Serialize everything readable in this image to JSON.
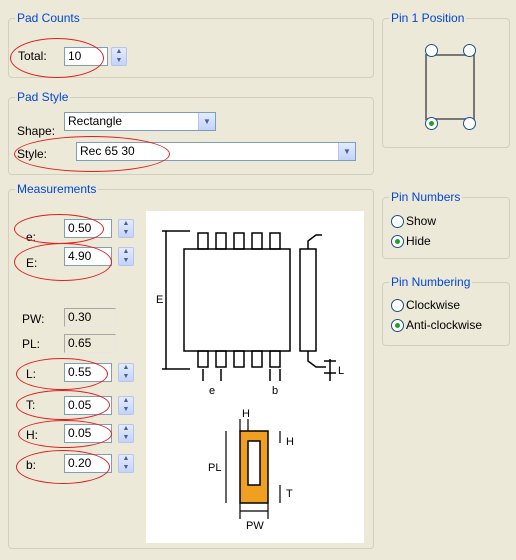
{
  "pad_counts": {
    "title": "Pad Counts",
    "total_label": "Total:",
    "total_value": "10"
  },
  "pad_style": {
    "title": "Pad Style",
    "shape_label": "Shape:",
    "shape_value": "Rectangle",
    "style_label": "Style:",
    "style_value": "Rec 65 30"
  },
  "measurements": {
    "title": "Measurements",
    "e_label": "e:",
    "e_value": "0.50",
    "E_label": "E:",
    "E_value": "4.90",
    "PW_label": "PW:",
    "PW_value": "0.30",
    "PL_label": "PL:",
    "PL_value": "0.65",
    "L_label": "L:",
    "L_value": "0.55",
    "T_label": "T:",
    "T_value": "0.05",
    "H_label": "H:",
    "H_value": "0.05",
    "b_label": "b:",
    "b_value": "0.20"
  },
  "diagram": {
    "E": "E",
    "e": "e",
    "b": "b",
    "L": "L",
    "H": "H",
    "PL": "PL",
    "T": "T",
    "PW": "PW"
  },
  "pin1_position": {
    "title": "Pin 1 Position",
    "selected": "bottom-left"
  },
  "pin_numbers": {
    "title": "Pin Numbers",
    "options": [
      "Show",
      "Hide"
    ],
    "selected": "Hide"
  },
  "pin_numbering": {
    "title": "Pin Numbering",
    "options": [
      "Clockwise",
      "Anti-clockwise"
    ],
    "selected": "Anti-clockwise"
  },
  "colors": {
    "accent": "#0046d5",
    "highlight_ring": "#e02020",
    "pad": "#f0a020"
  }
}
